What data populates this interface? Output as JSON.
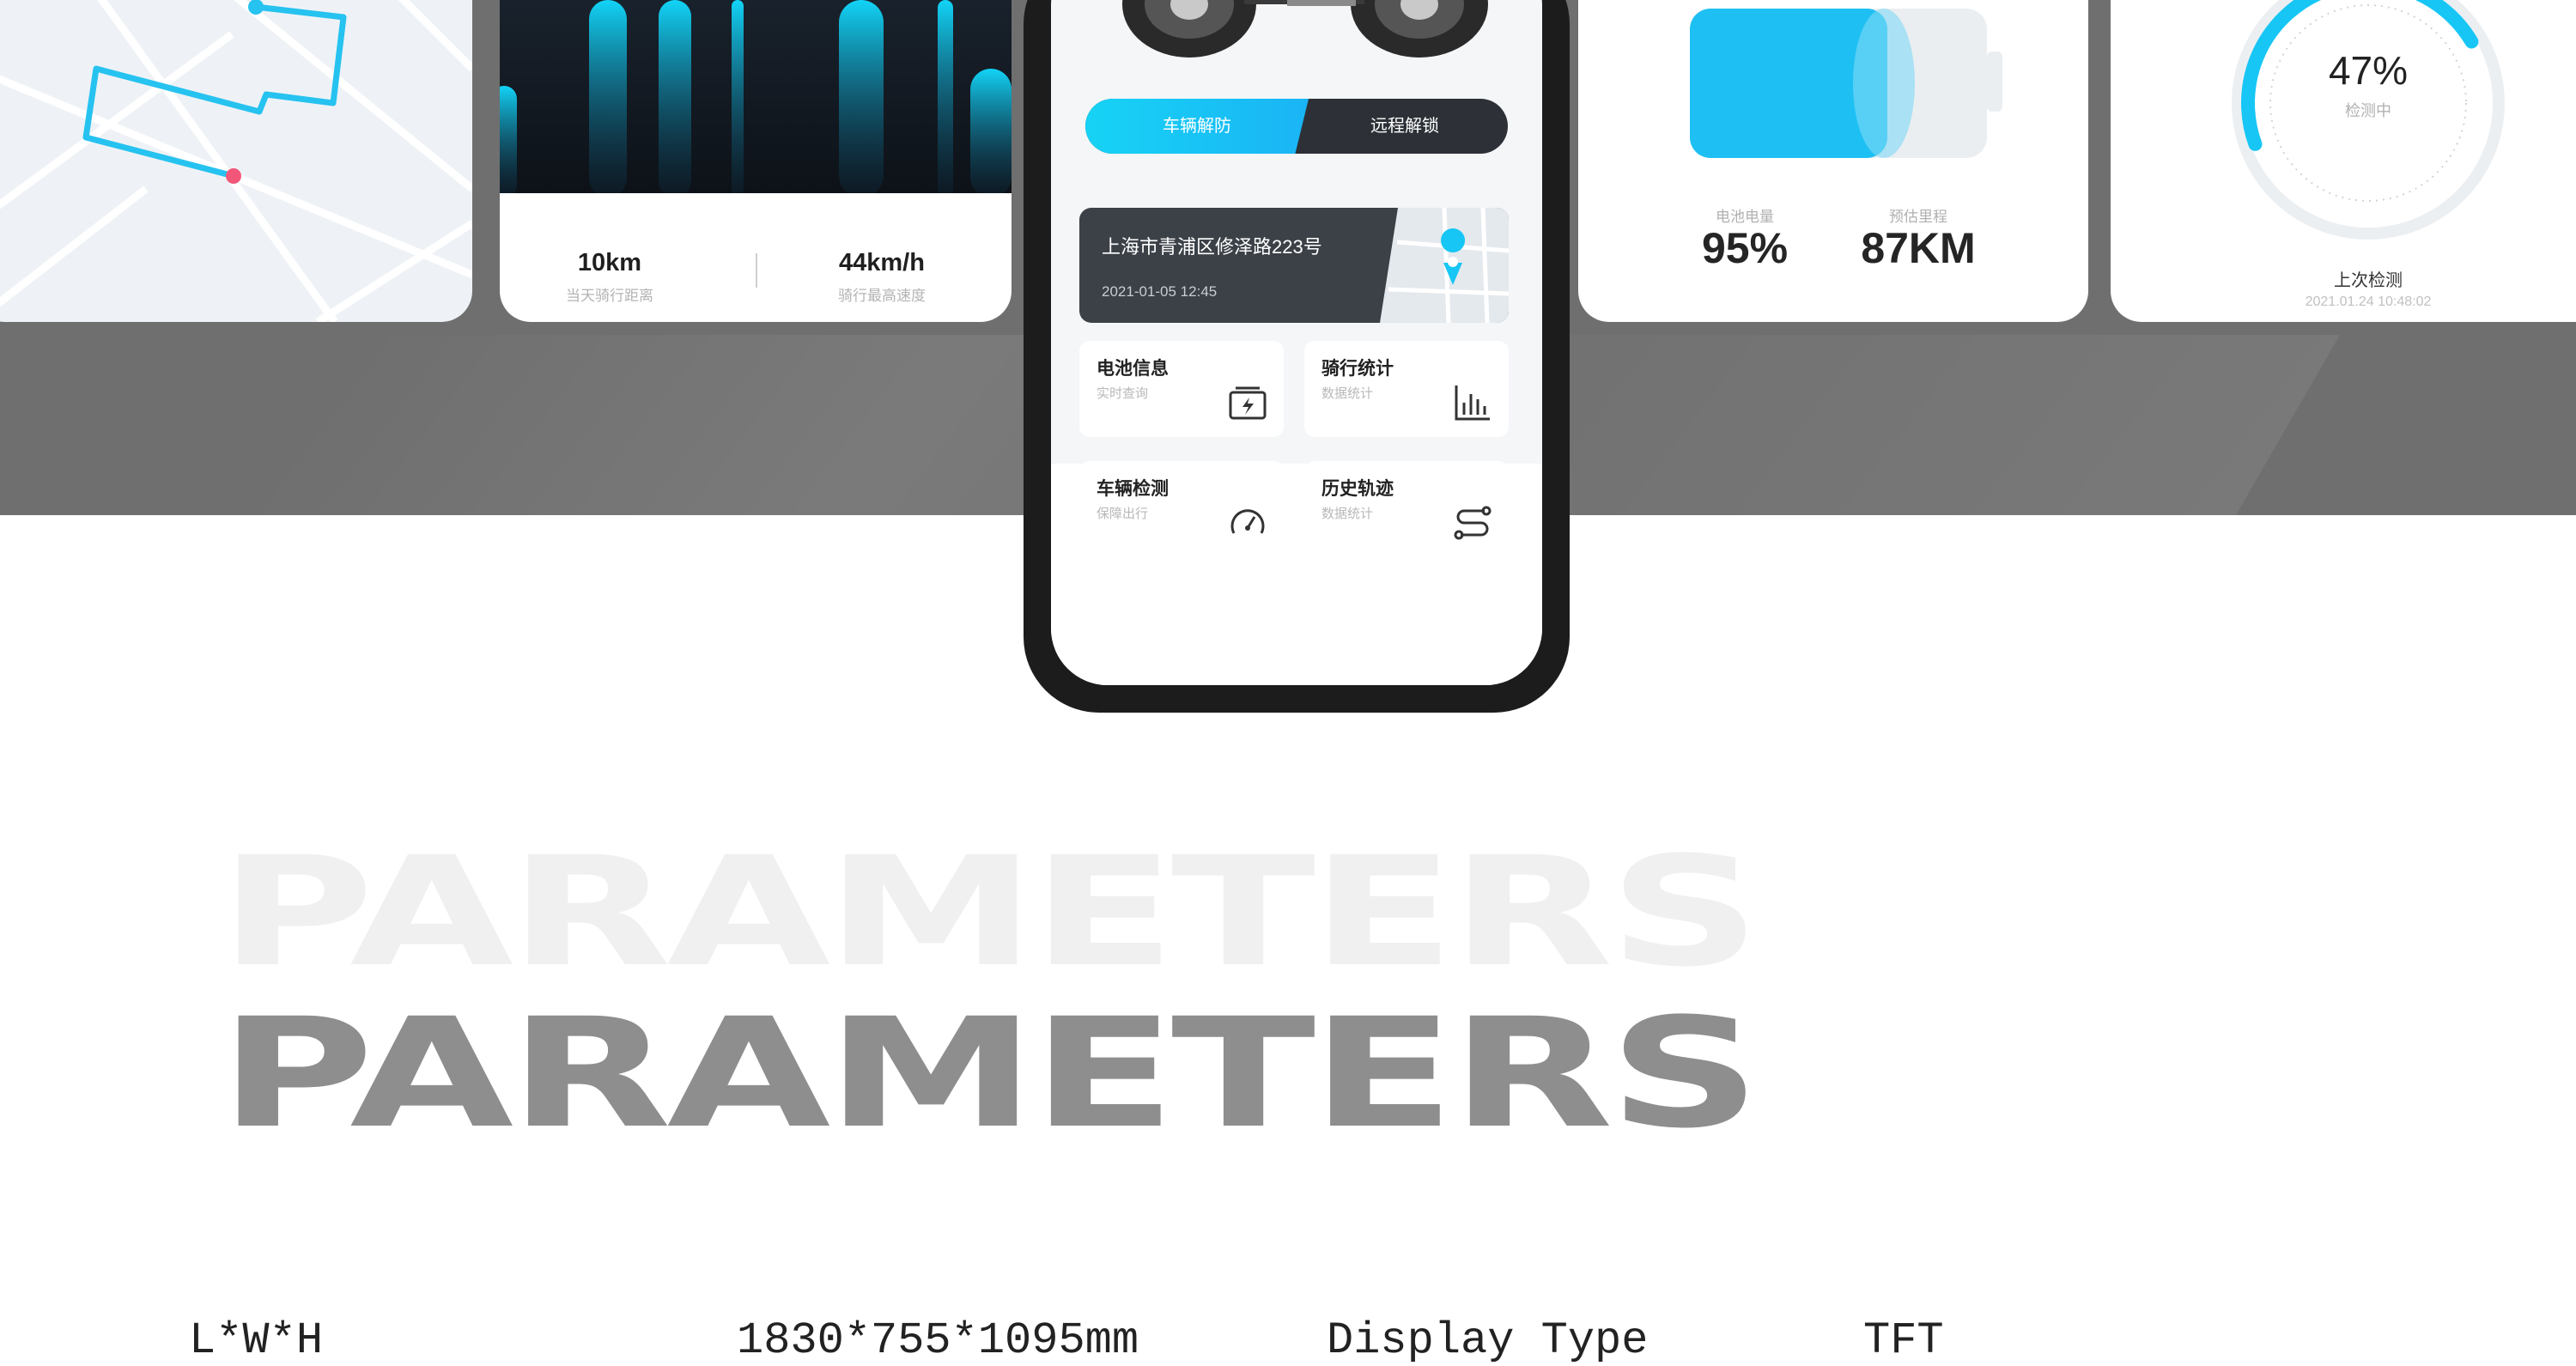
{
  "chart_card": {
    "stat1_value": "10km",
    "stat1_label": "当天骑行距离",
    "stat2_value": "44km/h",
    "stat2_label": "骑行最高速度"
  },
  "phone": {
    "toggle_left": "车辆解防",
    "toggle_right": "远程解锁",
    "address": "上海市青浦区修泽路223号",
    "timestamp": "2021-01-05 12:45",
    "tiles": [
      {
        "title": "电池信息",
        "subtitle": "实时查询",
        "icon": "battery-icon"
      },
      {
        "title": "骑行统计",
        "subtitle": "数据统计",
        "icon": "bar-chart-icon"
      },
      {
        "title": "车辆检测",
        "subtitle": "保障出行",
        "icon": "speedometer-icon"
      },
      {
        "title": "历史轨迹",
        "subtitle": "数据统计",
        "icon": "route-icon"
      }
    ]
  },
  "battery_card": {
    "level_label": "电池电量",
    "level_value": "95%",
    "range_label": "预估里程",
    "range_value": "87KM",
    "level_fraction": 0.95
  },
  "gauge_card": {
    "percent": "47%",
    "status": "检测中",
    "title": "上次检测",
    "time": "2021.01.24  10:48:02",
    "progress_fraction": 0.47
  },
  "heading": {
    "ghost": "PARAMETERS",
    "main": "PARAMETERS"
  },
  "params": {
    "label1": "L*W*H",
    "value1": "1830*755*1095mm",
    "label2": "Display Type",
    "value2": "TFT"
  },
  "colors": {
    "accent": "#17c6f5",
    "dark": "#2d3137",
    "band": "#6f6f6f",
    "route_end": "#f2577a"
  }
}
